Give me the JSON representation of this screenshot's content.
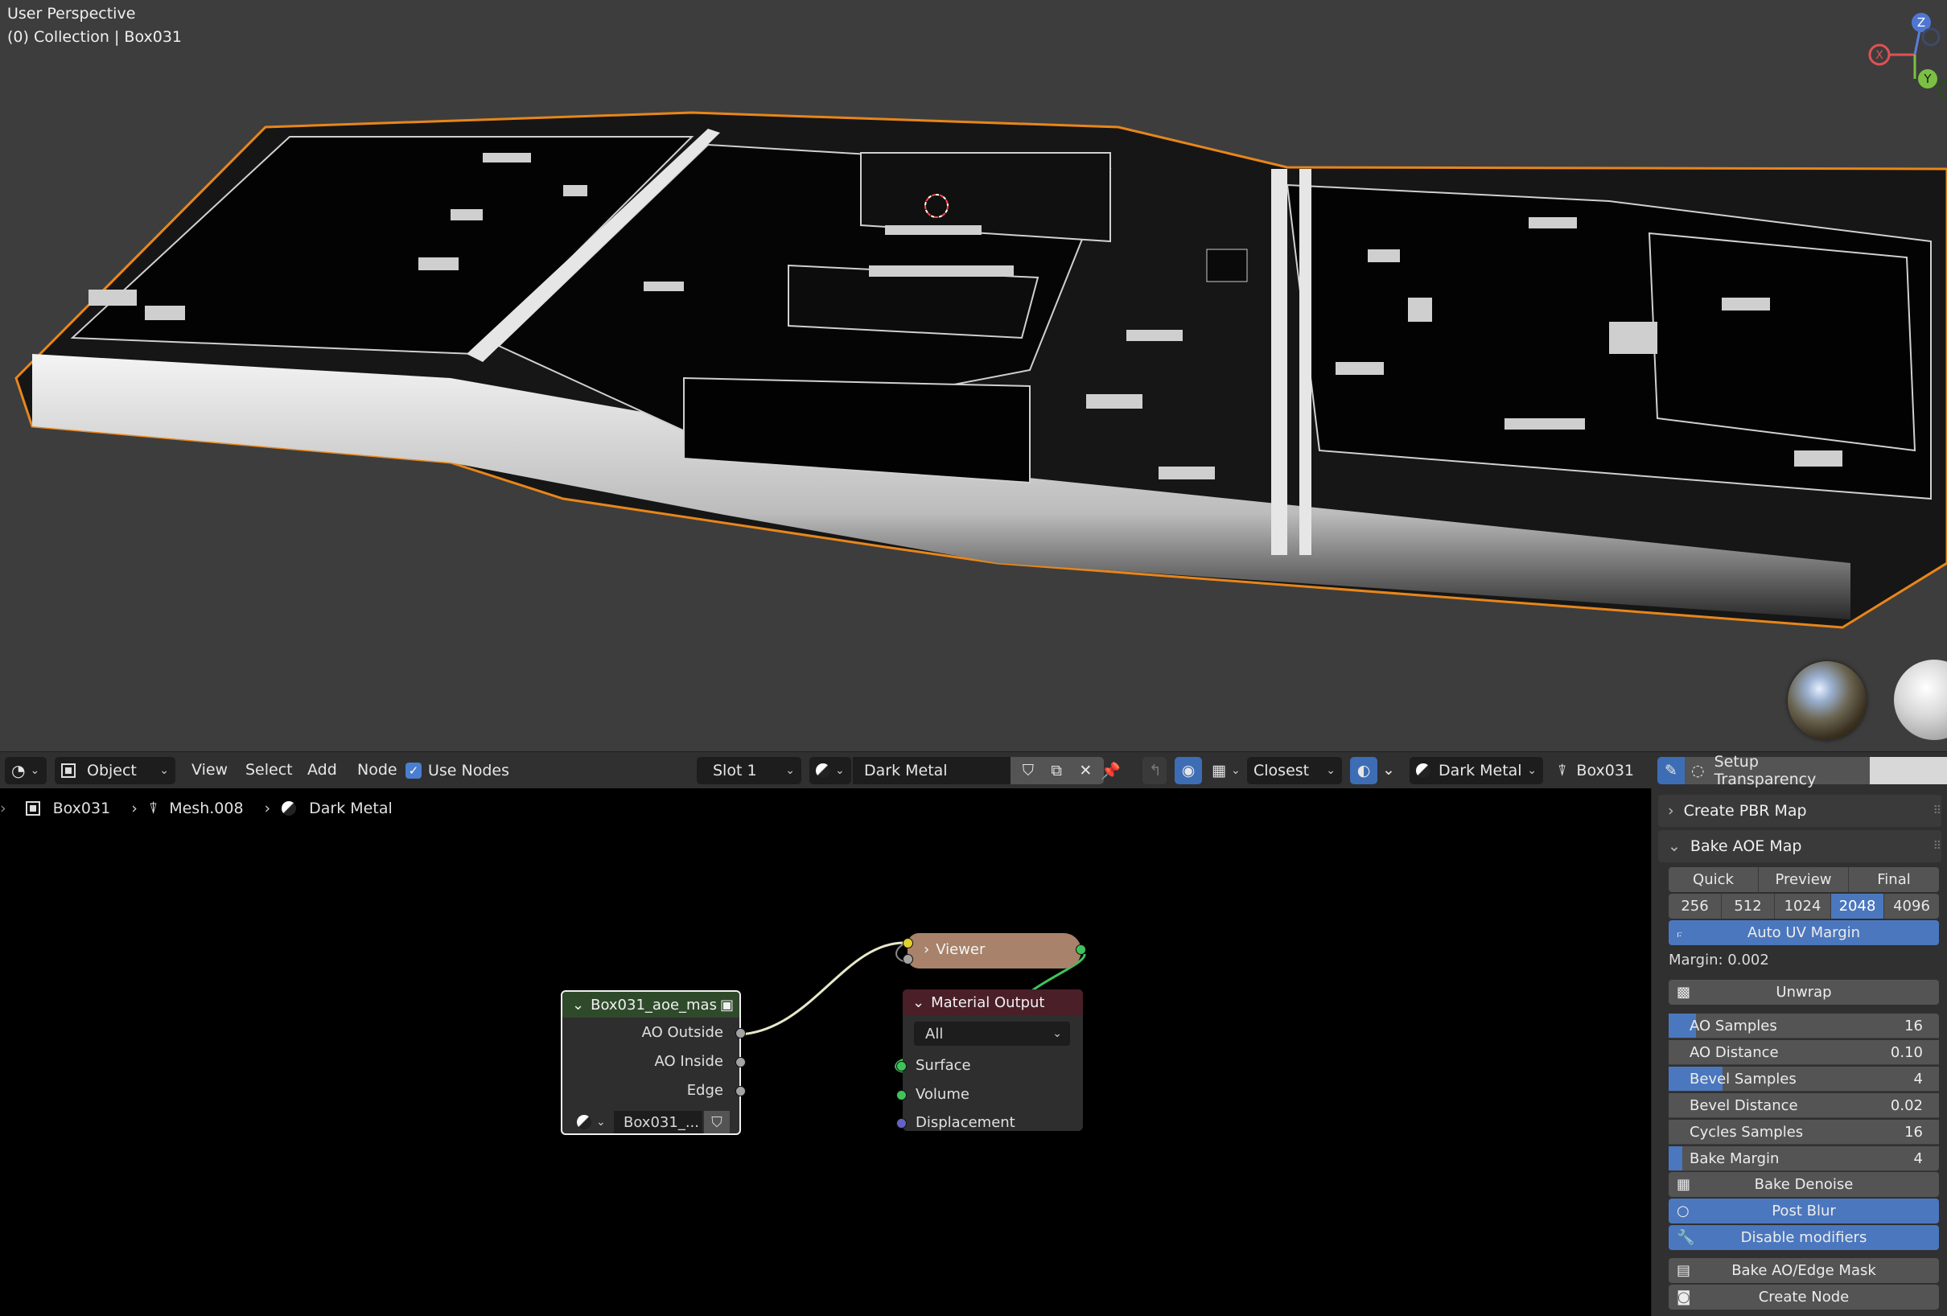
{
  "viewport": {
    "title": "User Perspective",
    "subtitle": "(0) Collection | Box031",
    "gizmo": {
      "z": "Z",
      "y": "Y",
      "x": "X"
    },
    "colors": {
      "background": "#3d3d3d",
      "selection_outline": "#e8861a"
    }
  },
  "header": {
    "mode": "Object",
    "menus": [
      "View",
      "Select",
      "Add",
      "Node"
    ],
    "use_nodes_label": "Use Nodes",
    "slot": "Slot 1",
    "material": "Dark Metal",
    "snap": "Closest",
    "material2": "Dark Metal",
    "object": "Box031",
    "setup_transparency": "Setup Transparency"
  },
  "breadcrumb": {
    "object": "Box031",
    "mesh": "Mesh.008",
    "material": "Dark Metal"
  },
  "nodes": {
    "image_node": {
      "title": "Box031_aoe_mas",
      "outputs": [
        "AO Outside",
        "AO Inside",
        "Edge"
      ],
      "image": "Box031_..."
    },
    "viewer": {
      "title": "Viewer"
    },
    "material_output": {
      "title": "Material Output",
      "target": "All",
      "inputs": [
        "Surface",
        "Volume",
        "Displacement"
      ]
    }
  },
  "sidebar": {
    "create_pbr": "Create PBR Map",
    "bake_aoe": "Bake AOE Map",
    "quality": [
      "Quick",
      "Preview",
      "Final"
    ],
    "resolutions": [
      "256",
      "512",
      "1024",
      "2048",
      "4096"
    ],
    "resolution_selected": "2048",
    "auto_uv_margin": "Auto UV Margin",
    "margin_text": "Margin: 0.002",
    "unwrap": "Unwrap",
    "props": [
      {
        "label": "AO Samples",
        "value": "16",
        "fill": 0.1
      },
      {
        "label": "AO Distance",
        "value": "0.10",
        "fill": 0
      },
      {
        "label": "Bevel Samples",
        "value": "4",
        "fill": 0.2
      },
      {
        "label": "Bevel Distance",
        "value": "0.02",
        "fill": 0
      },
      {
        "label": "Cycles Samples",
        "value": "16",
        "fill": 0
      },
      {
        "label": "Bake Margin",
        "value": "4",
        "fill": 0.05
      }
    ],
    "bake_denoise": "Bake Denoise",
    "post_blur": "Post Blur",
    "disable_modifiers": "Disable modifiers",
    "bake_ao_edge": "Bake AO/Edge Mask",
    "create_node": "Create Node"
  }
}
